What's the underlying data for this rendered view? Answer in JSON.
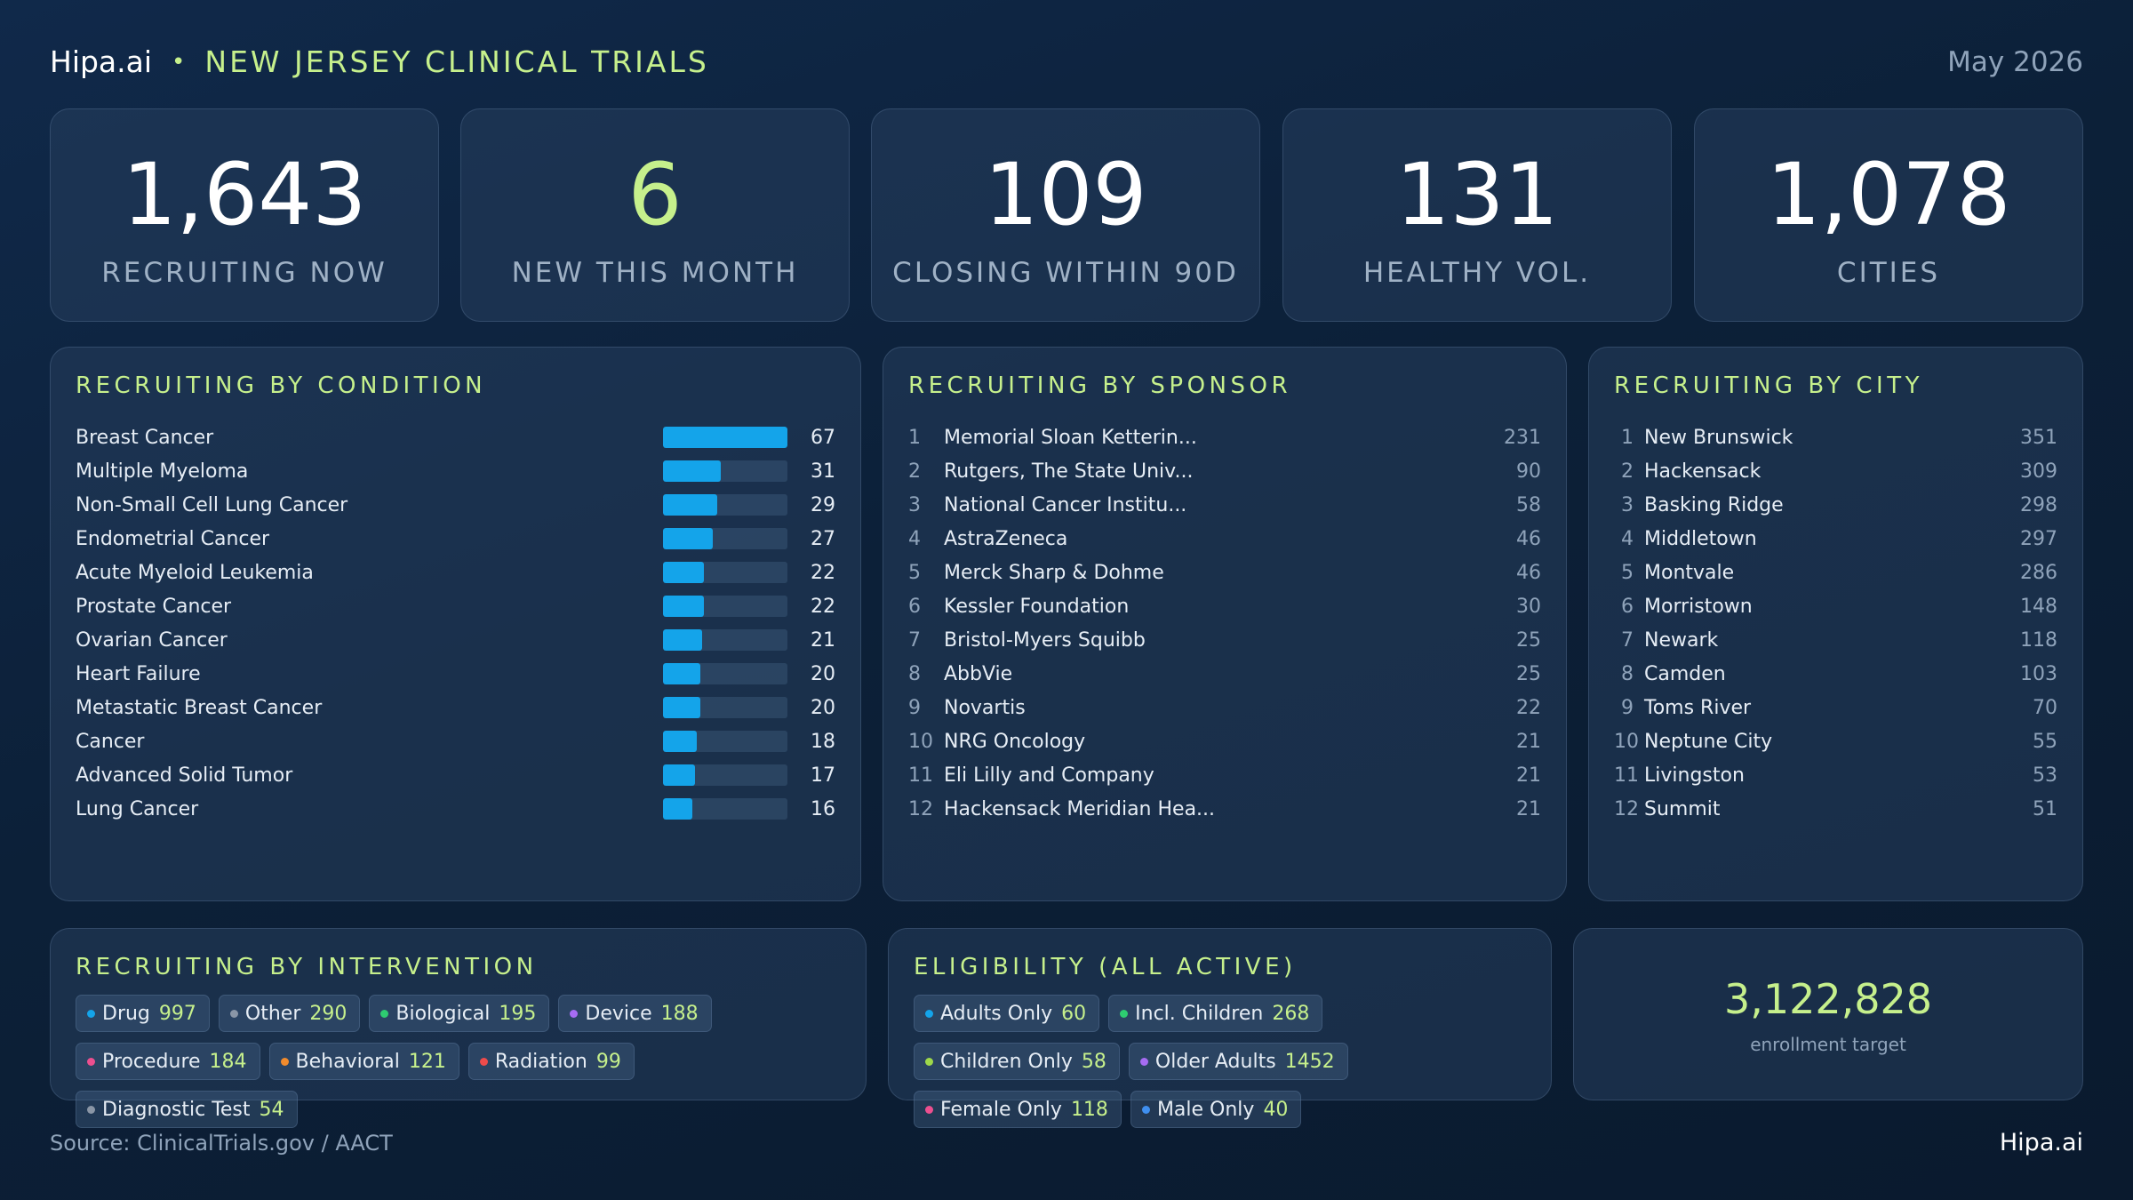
{
  "header": {
    "brand": "Hipa.ai",
    "separator": "•",
    "title": "NEW JERSEY CLINICAL TRIALS",
    "date": "May 2026"
  },
  "stats": [
    {
      "value": "1,643",
      "label": "RECRUITING NOW",
      "accent": false
    },
    {
      "value": "6",
      "label": "NEW THIS MONTH",
      "accent": true
    },
    {
      "value": "109",
      "label": "CLOSING WITHIN 90D",
      "accent": false
    },
    {
      "value": "131",
      "label": "HEALTHY VOL.",
      "accent": false
    },
    {
      "value": "1,078",
      "label": "CITIES",
      "accent": false
    }
  ],
  "conditions": {
    "title": "RECRUITING BY CONDITION",
    "max": 67,
    "items": [
      {
        "label": "Breast Cancer",
        "count": 67
      },
      {
        "label": "Multiple Myeloma",
        "count": 31
      },
      {
        "label": "Non-Small Cell Lung Cancer",
        "count": 29
      },
      {
        "label": "Endometrial Cancer",
        "count": 27
      },
      {
        "label": "Acute Myeloid Leukemia",
        "count": 22
      },
      {
        "label": "Prostate Cancer",
        "count": 22
      },
      {
        "label": "Ovarian Cancer",
        "count": 21
      },
      {
        "label": "Heart Failure",
        "count": 20
      },
      {
        "label": "Metastatic Breast Cancer",
        "count": 20
      },
      {
        "label": "Cancer",
        "count": 18
      },
      {
        "label": "Advanced Solid Tumor",
        "count": 17
      },
      {
        "label": "Lung Cancer",
        "count": 16
      }
    ]
  },
  "sponsors": {
    "title": "RECRUITING BY SPONSOR",
    "items": [
      {
        "rank": "1",
        "name": "Memorial Sloan Ketterin...",
        "count": "231"
      },
      {
        "rank": "2",
        "name": "Rutgers, The State Univ...",
        "count": "90"
      },
      {
        "rank": "3",
        "name": "National Cancer Institu...",
        "count": "58"
      },
      {
        "rank": "4",
        "name": "AstraZeneca",
        "count": "46"
      },
      {
        "rank": "5",
        "name": "Merck Sharp & Dohme",
        "count": "46"
      },
      {
        "rank": "6",
        "name": "Kessler Foundation",
        "count": "30"
      },
      {
        "rank": "7",
        "name": "Bristol-Myers Squibb",
        "count": "25"
      },
      {
        "rank": "8",
        "name": "AbbVie",
        "count": "25"
      },
      {
        "rank": "9",
        "name": "Novartis",
        "count": "22"
      },
      {
        "rank": "10",
        "name": "NRG Oncology",
        "count": "21"
      },
      {
        "rank": "11",
        "name": "Eli Lilly and Company",
        "count": "21"
      },
      {
        "rank": "12",
        "name": "Hackensack Meridian Hea...",
        "count": "21"
      }
    ]
  },
  "cities": {
    "title": "RECRUITING BY CITY",
    "items": [
      {
        "rank": "1",
        "name": "New Brunswick",
        "count": "351"
      },
      {
        "rank": "2",
        "name": "Hackensack",
        "count": "309"
      },
      {
        "rank": "3",
        "name": "Basking Ridge",
        "count": "298"
      },
      {
        "rank": "4",
        "name": "Middletown",
        "count": "297"
      },
      {
        "rank": "5",
        "name": "Montvale",
        "count": "286"
      },
      {
        "rank": "6",
        "name": "Morristown",
        "count": "148"
      },
      {
        "rank": "7",
        "name": "Newark",
        "count": "118"
      },
      {
        "rank": "8",
        "name": "Camden",
        "count": "103"
      },
      {
        "rank": "9",
        "name": "Toms River",
        "count": "70"
      },
      {
        "rank": "10",
        "name": "Neptune City",
        "count": "55"
      },
      {
        "rank": "11",
        "name": "Livingston",
        "count": "53"
      },
      {
        "rank": "12",
        "name": "Summit",
        "count": "51"
      }
    ]
  },
  "interventions": {
    "title": "RECRUITING BY INTERVENTION",
    "items": [
      {
        "label": "Drug",
        "count": "997",
        "color": "#14a4ea"
      },
      {
        "label": "Other",
        "count": "290",
        "color": "#8a96a6"
      },
      {
        "label": "Biological",
        "count": "195",
        "color": "#2ecc71"
      },
      {
        "label": "Device",
        "count": "188",
        "color": "#a66cf2"
      },
      {
        "label": "Procedure",
        "count": "184",
        "color": "#ec4f8f"
      },
      {
        "label": "Behavioral",
        "count": "121",
        "color": "#f28b2c"
      },
      {
        "label": "Radiation",
        "count": "99",
        "color": "#ee4b4b"
      },
      {
        "label": "Diagnostic Test",
        "count": "54",
        "color": "#8a96a6"
      }
    ]
  },
  "eligibility": {
    "title": "ELIGIBILITY (ALL ACTIVE)",
    "items": [
      {
        "label": "Adults Only",
        "count": "60",
        "color": "#14a4ea"
      },
      {
        "label": "Incl. Children",
        "count": "268",
        "color": "#2ecc71"
      },
      {
        "label": "Children Only",
        "count": "58",
        "color": "#9ed84a"
      },
      {
        "label": "Older Adults",
        "count": "1452",
        "color": "#a66cf2"
      },
      {
        "label": "Female Only",
        "count": "118",
        "color": "#ec4f8f"
      },
      {
        "label": "Male Only",
        "count": "40",
        "color": "#3f8ff0"
      }
    ]
  },
  "enrollment": {
    "value": "3,122,828",
    "label": "enrollment target"
  },
  "footer": {
    "source": "Source: ClinicalTrials.gov / AACT",
    "brand": "Hipa.ai"
  }
}
